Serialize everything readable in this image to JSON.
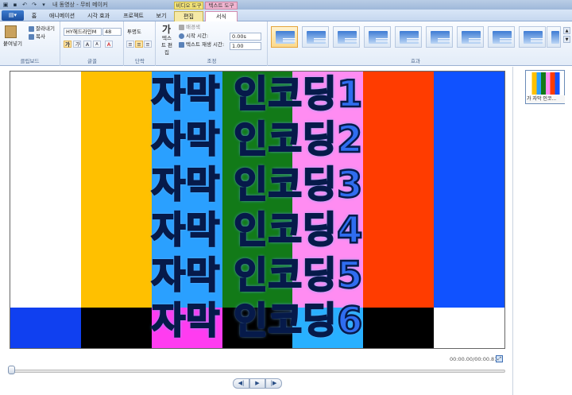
{
  "window": {
    "title": "내 동영상 - 무비 메이커"
  },
  "contextual_tabs": {
    "video_tools": "비디오 도구",
    "text_tools": "텍스트 도구"
  },
  "tabs": [
    "홈",
    "애니메이션",
    "시각 효과",
    "프로젝트",
    "보기",
    "편집",
    "서식"
  ],
  "ribbon": {
    "clipboard": {
      "paste": "붙여넣기",
      "cut": "잘라내기",
      "copy": "복사",
      "label": "클립보드"
    },
    "font": {
      "family": "HY헤드라인M",
      "size": "48",
      "bold": "가",
      "italic": "가",
      "grow": "A",
      "shrink": "A",
      "label": "글꼴"
    },
    "paragraph": {
      "transparency": "투명도",
      "label": "단락"
    },
    "adjust": {
      "edit_text": "텍스트 편집",
      "background": "배경색",
      "start_time_label": "시작 시간:",
      "start_time": "0.00s",
      "duration_label": "텍스트 재생 시간:",
      "duration": "1.00",
      "label": "조정"
    },
    "effects": {
      "label": "효과"
    }
  },
  "preview": {
    "subtitles": [
      "자막 인코딩1",
      "자막 인코딩2",
      "자막 인코딩3",
      "자막 인코딩4",
      "자막 인코딩5",
      "자막 인코딩6"
    ]
  },
  "playback": {
    "timecode": "00:00.00/00:00.81",
    "prev": "◀|",
    "play": "▶",
    "next": "|▶"
  },
  "storyboard": {
    "caption": "가 자막 인코..."
  },
  "colors": {
    "bars": [
      "#ffffff",
      "#ffc000",
      "#2aa0ff",
      "#127a18",
      "#ff8cf2",
      "#ff3c00",
      "#1052ff"
    ],
    "lower": [
      "#1040f0",
      "#000000",
      "#ff3cf0",
      "#000000",
      "#28b0ff",
      "#000000",
      "#ffffff"
    ],
    "accent": "#2f6df0"
  }
}
